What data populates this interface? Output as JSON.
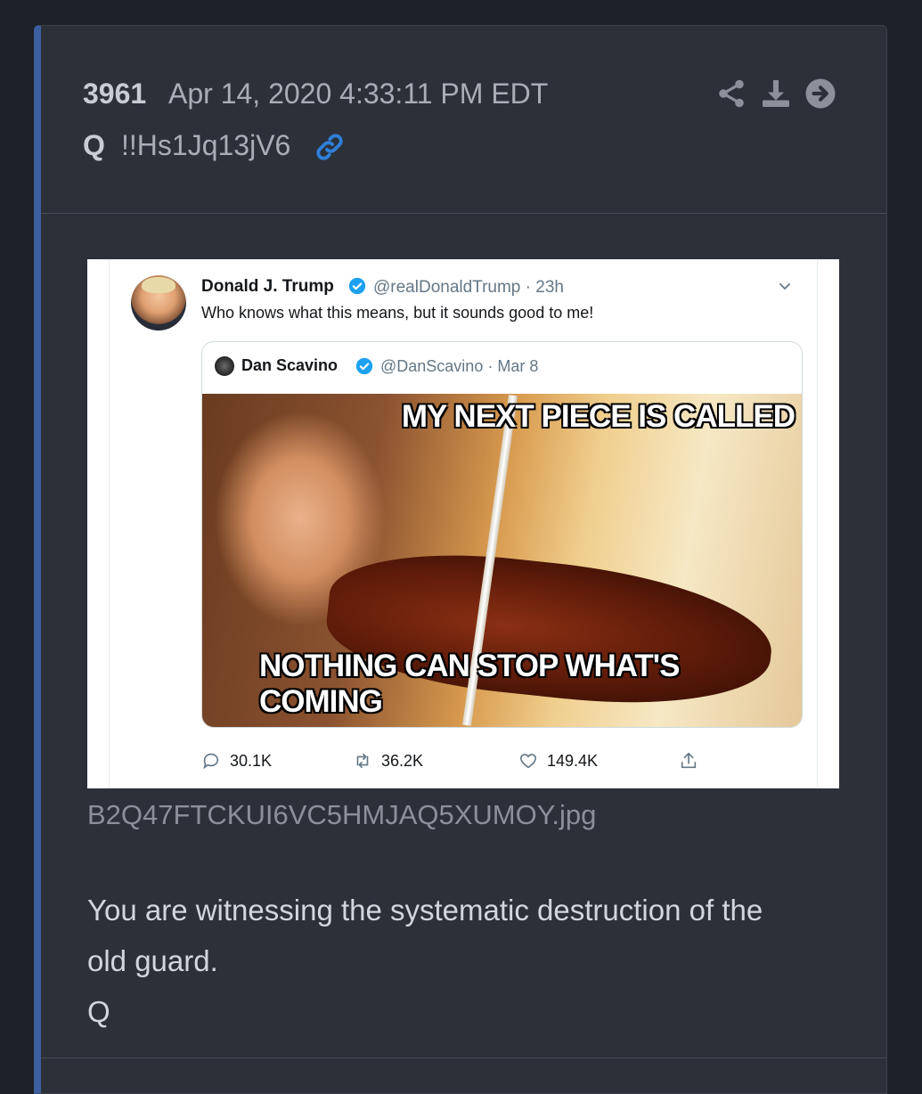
{
  "post": {
    "number": "3961",
    "date": "Apr 14, 2020 4:33:11 PM EDT",
    "author": "Q",
    "tripcode": "!!Hs1Jq13jV6",
    "actions": [
      "share-icon",
      "download-icon",
      "arrow-right-circle-icon"
    ],
    "filename": "B2Q47FTCKUI6VC5HMJAQ5XUMOY.jpg",
    "body_lines": [
      "You are witnessing the systematic destruction of the",
      "old guard.",
      "Q"
    ],
    "accent_color": "#3b5fa0"
  },
  "tweet": {
    "name": "Donald J. Trump",
    "handle": "@realDonaldTrump · 23h",
    "text": "Who knows what this means, but it sounds good to me!",
    "quote": {
      "name": "Dan Scavino",
      "handle": "@DanScavino · Mar 8",
      "meme_top": "MY NEXT PIECE IS CALLED",
      "meme_bottom": "NOTHING CAN STOP WHAT'S COMING"
    },
    "replies": "30.1K",
    "retweets": "36.2K",
    "likes": "149.4K",
    "verified_color": "#1da1f2"
  }
}
